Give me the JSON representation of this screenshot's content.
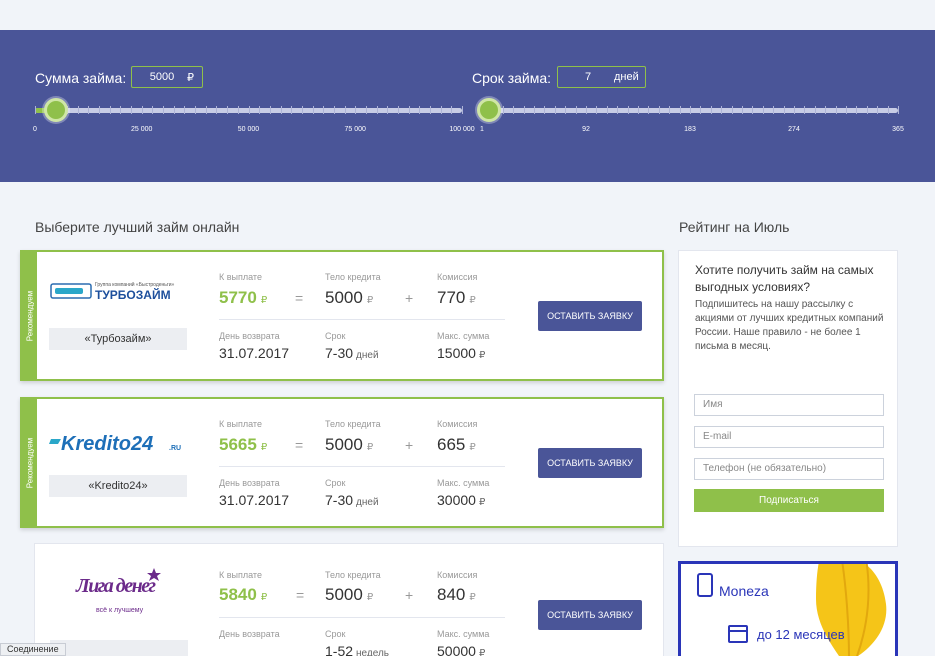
{
  "amount_slider": {
    "label": "Сумма займа:",
    "value": "5000",
    "unit": "₽",
    "ticks": [
      "0",
      "25 000",
      "50 000",
      "75 000",
      "100 000"
    ],
    "fill_fraction": 0.05
  },
  "term_slider": {
    "label": "Срок займа:",
    "value": "7",
    "unit": "дней",
    "ticks": [
      "1",
      "92",
      "183",
      "274",
      "365"
    ],
    "fill_fraction": 0.016
  },
  "offers_title": "Выберите лучший займ онлайн",
  "rating_title": "Рейтинг на Июль",
  "labels": {
    "payout": "К выплате",
    "body": "Тело кредита",
    "commission": "Комиссия",
    "return_day": "День возврата",
    "term": "Срок",
    "max_sum": "Макс. сумма",
    "currency": "₽",
    "recommended": "Рекомендуем",
    "apply": "Оставить заявку",
    "equals": "=",
    "plus": "+"
  },
  "offers": [
    {
      "name": "«Турбозайм»",
      "logo_text": "ТУРБОЗАЙМ",
      "logo_sub": "Группа компаний «Быстроденьги»",
      "payout": "5770",
      "body": "5000",
      "commission": "770",
      "return_day": "31.07.2017",
      "term": "7-30",
      "term_unit": "дней",
      "max_sum": "15000",
      "recommended": true
    },
    {
      "name": "«Kredito24»",
      "logo_text": "Kredito24",
      "logo_sub": ".RU",
      "payout": "5665",
      "body": "5000",
      "commission": "665",
      "return_day": "31.07.2017",
      "term": "7-30",
      "term_unit": "дней",
      "max_sum": "30000",
      "recommended": true
    },
    {
      "name": "",
      "logo_text": "Лига денег",
      "logo_sub": "всё к лучшему",
      "payout": "5840",
      "body": "5000",
      "commission": "840",
      "return_day": "",
      "term": "1-52",
      "term_unit": "недель",
      "max_sum": "50000",
      "recommended": false
    }
  ],
  "subscribe": {
    "heading": "Хотите получить займ на самых выгодных условиях?",
    "text": "Подпишитесь на нашу рассылку с акциями от лучших кредитных компаний России. Наше правило - не более 1 письма в месяц.",
    "name_placeholder": "Имя",
    "email_placeholder": "E-mail",
    "phone_placeholder": "Телефон (не обязательно)",
    "button": "Подписаться"
  },
  "banner": {
    "brand": "Moneza",
    "term": "до 12 месяцев",
    "accent": "#2a35b8",
    "balloon": "#f5c518"
  },
  "status_bar": "Соединение",
  "colors": {
    "hero": "#4a5598",
    "green": "#8fc04a",
    "button": "#4a5598"
  }
}
